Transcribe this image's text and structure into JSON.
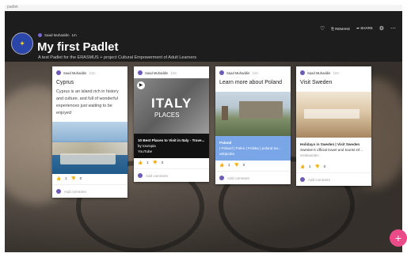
{
  "app_label": "padlet",
  "header": {
    "user": "Saad Muhaddin",
    "time": "1m",
    "title": "My first Padlet",
    "subtitle": "A test Padlet for the ERASMUS + project Cultural Empowerment of Adult Learners",
    "actions": {
      "remake": "REMAKE",
      "share": "SHARE"
    }
  },
  "cards": [
    {
      "user": "Saad Muhaddin",
      "time": "12m",
      "title": "Cyprus",
      "body": "Cyprus is an island rich in history and culture, and full of wonderful experiences just waiting to be enjoyed",
      "likes": "1",
      "dislikes": "0",
      "comment_placeholder": "Add comment"
    },
    {
      "user": "Saad Muhaddin",
      "time": "12m",
      "image_text_1": "ITALY",
      "image_text_2": "PLACES",
      "attach_title": "10 Best Places to Visit in Italy - Trave...",
      "attach_by": "by touropia",
      "attach_source": "YouTube",
      "likes": "1",
      "dislikes": "0",
      "comment_placeholder": "Add comment"
    },
    {
      "user": "Saad Muhaddin",
      "time": "12m",
      "title": "Learn more about Poland",
      "attach_title": "Poland",
      "attach_desc": "| Poland | Polen | Polska | poland.tra...",
      "attach_source": "wikipedia",
      "likes": "1",
      "dislikes": "0",
      "comment_placeholder": "Add comment"
    },
    {
      "user": "Saad Muhaddin",
      "time": "12m",
      "title": "Visit Sweden",
      "attach_title": "Holidays in Sweden | Visit Sweden",
      "attach_desc": "Sweden's official travel and tourist inf...",
      "attach_source": "visitsweden",
      "likes": "1",
      "dislikes": "0",
      "comment_placeholder": "Add comment"
    }
  ],
  "fab_label": "+",
  "colors": {
    "fab": "#ea4c89",
    "header": "#1d1d1d",
    "poland_attach": "#7aa6e8",
    "italy_attach": "#111111"
  },
  "icons": [
    "heart-icon",
    "remake-icon",
    "share-icon",
    "gear-icon",
    "more-icon",
    "like-icon",
    "dislike-icon",
    "play-icon",
    "plus-icon"
  ]
}
